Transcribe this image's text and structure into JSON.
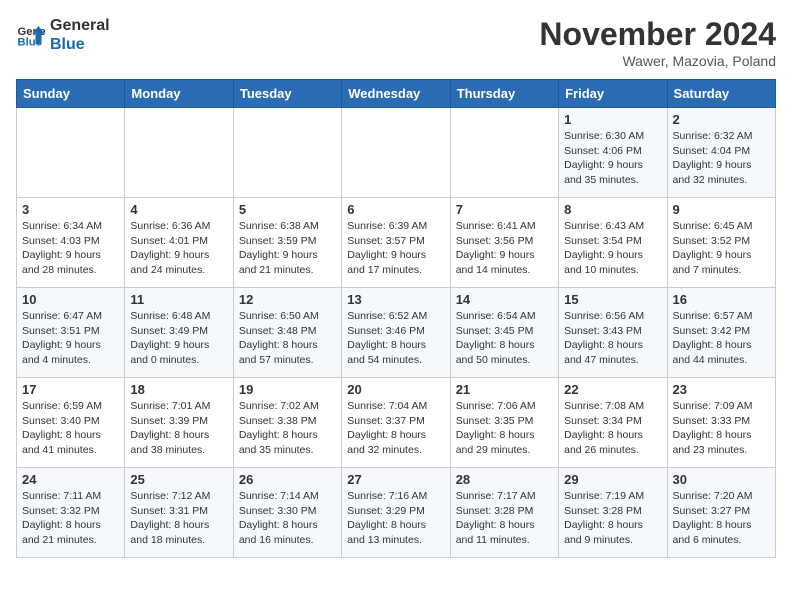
{
  "header": {
    "logo_line1": "General",
    "logo_line2": "Blue",
    "month": "November 2024",
    "location": "Wawer, Mazovia, Poland"
  },
  "weekdays": [
    "Sunday",
    "Monday",
    "Tuesday",
    "Wednesday",
    "Thursday",
    "Friday",
    "Saturday"
  ],
  "weeks": [
    [
      {
        "day": "",
        "detail": ""
      },
      {
        "day": "",
        "detail": ""
      },
      {
        "day": "",
        "detail": ""
      },
      {
        "day": "",
        "detail": ""
      },
      {
        "day": "",
        "detail": ""
      },
      {
        "day": "1",
        "detail": "Sunrise: 6:30 AM\nSunset: 4:06 PM\nDaylight: 9 hours\nand 35 minutes."
      },
      {
        "day": "2",
        "detail": "Sunrise: 6:32 AM\nSunset: 4:04 PM\nDaylight: 9 hours\nand 32 minutes."
      }
    ],
    [
      {
        "day": "3",
        "detail": "Sunrise: 6:34 AM\nSunset: 4:03 PM\nDaylight: 9 hours\nand 28 minutes."
      },
      {
        "day": "4",
        "detail": "Sunrise: 6:36 AM\nSunset: 4:01 PM\nDaylight: 9 hours\nand 24 minutes."
      },
      {
        "day": "5",
        "detail": "Sunrise: 6:38 AM\nSunset: 3:59 PM\nDaylight: 9 hours\nand 21 minutes."
      },
      {
        "day": "6",
        "detail": "Sunrise: 6:39 AM\nSunset: 3:57 PM\nDaylight: 9 hours\nand 17 minutes."
      },
      {
        "day": "7",
        "detail": "Sunrise: 6:41 AM\nSunset: 3:56 PM\nDaylight: 9 hours\nand 14 minutes."
      },
      {
        "day": "8",
        "detail": "Sunrise: 6:43 AM\nSunset: 3:54 PM\nDaylight: 9 hours\nand 10 minutes."
      },
      {
        "day": "9",
        "detail": "Sunrise: 6:45 AM\nSunset: 3:52 PM\nDaylight: 9 hours\nand 7 minutes."
      }
    ],
    [
      {
        "day": "10",
        "detail": "Sunrise: 6:47 AM\nSunset: 3:51 PM\nDaylight: 9 hours\nand 4 minutes."
      },
      {
        "day": "11",
        "detail": "Sunrise: 6:48 AM\nSunset: 3:49 PM\nDaylight: 9 hours\nand 0 minutes."
      },
      {
        "day": "12",
        "detail": "Sunrise: 6:50 AM\nSunset: 3:48 PM\nDaylight: 8 hours\nand 57 minutes."
      },
      {
        "day": "13",
        "detail": "Sunrise: 6:52 AM\nSunset: 3:46 PM\nDaylight: 8 hours\nand 54 minutes."
      },
      {
        "day": "14",
        "detail": "Sunrise: 6:54 AM\nSunset: 3:45 PM\nDaylight: 8 hours\nand 50 minutes."
      },
      {
        "day": "15",
        "detail": "Sunrise: 6:56 AM\nSunset: 3:43 PM\nDaylight: 8 hours\nand 47 minutes."
      },
      {
        "day": "16",
        "detail": "Sunrise: 6:57 AM\nSunset: 3:42 PM\nDaylight: 8 hours\nand 44 minutes."
      }
    ],
    [
      {
        "day": "17",
        "detail": "Sunrise: 6:59 AM\nSunset: 3:40 PM\nDaylight: 8 hours\nand 41 minutes."
      },
      {
        "day": "18",
        "detail": "Sunrise: 7:01 AM\nSunset: 3:39 PM\nDaylight: 8 hours\nand 38 minutes."
      },
      {
        "day": "19",
        "detail": "Sunrise: 7:02 AM\nSunset: 3:38 PM\nDaylight: 8 hours\nand 35 minutes."
      },
      {
        "day": "20",
        "detail": "Sunrise: 7:04 AM\nSunset: 3:37 PM\nDaylight: 8 hours\nand 32 minutes."
      },
      {
        "day": "21",
        "detail": "Sunrise: 7:06 AM\nSunset: 3:35 PM\nDaylight: 8 hours\nand 29 minutes."
      },
      {
        "day": "22",
        "detail": "Sunrise: 7:08 AM\nSunset: 3:34 PM\nDaylight: 8 hours\nand 26 minutes."
      },
      {
        "day": "23",
        "detail": "Sunrise: 7:09 AM\nSunset: 3:33 PM\nDaylight: 8 hours\nand 23 minutes."
      }
    ],
    [
      {
        "day": "24",
        "detail": "Sunrise: 7:11 AM\nSunset: 3:32 PM\nDaylight: 8 hours\nand 21 minutes."
      },
      {
        "day": "25",
        "detail": "Sunrise: 7:12 AM\nSunset: 3:31 PM\nDaylight: 8 hours\nand 18 minutes."
      },
      {
        "day": "26",
        "detail": "Sunrise: 7:14 AM\nSunset: 3:30 PM\nDaylight: 8 hours\nand 16 minutes."
      },
      {
        "day": "27",
        "detail": "Sunrise: 7:16 AM\nSunset: 3:29 PM\nDaylight: 8 hours\nand 13 minutes."
      },
      {
        "day": "28",
        "detail": "Sunrise: 7:17 AM\nSunset: 3:28 PM\nDaylight: 8 hours\nand 11 minutes."
      },
      {
        "day": "29",
        "detail": "Sunrise: 7:19 AM\nSunset: 3:28 PM\nDaylight: 8 hours\nand 9 minutes."
      },
      {
        "day": "30",
        "detail": "Sunrise: 7:20 AM\nSunset: 3:27 PM\nDaylight: 8 hours\nand 6 minutes."
      }
    ]
  ]
}
